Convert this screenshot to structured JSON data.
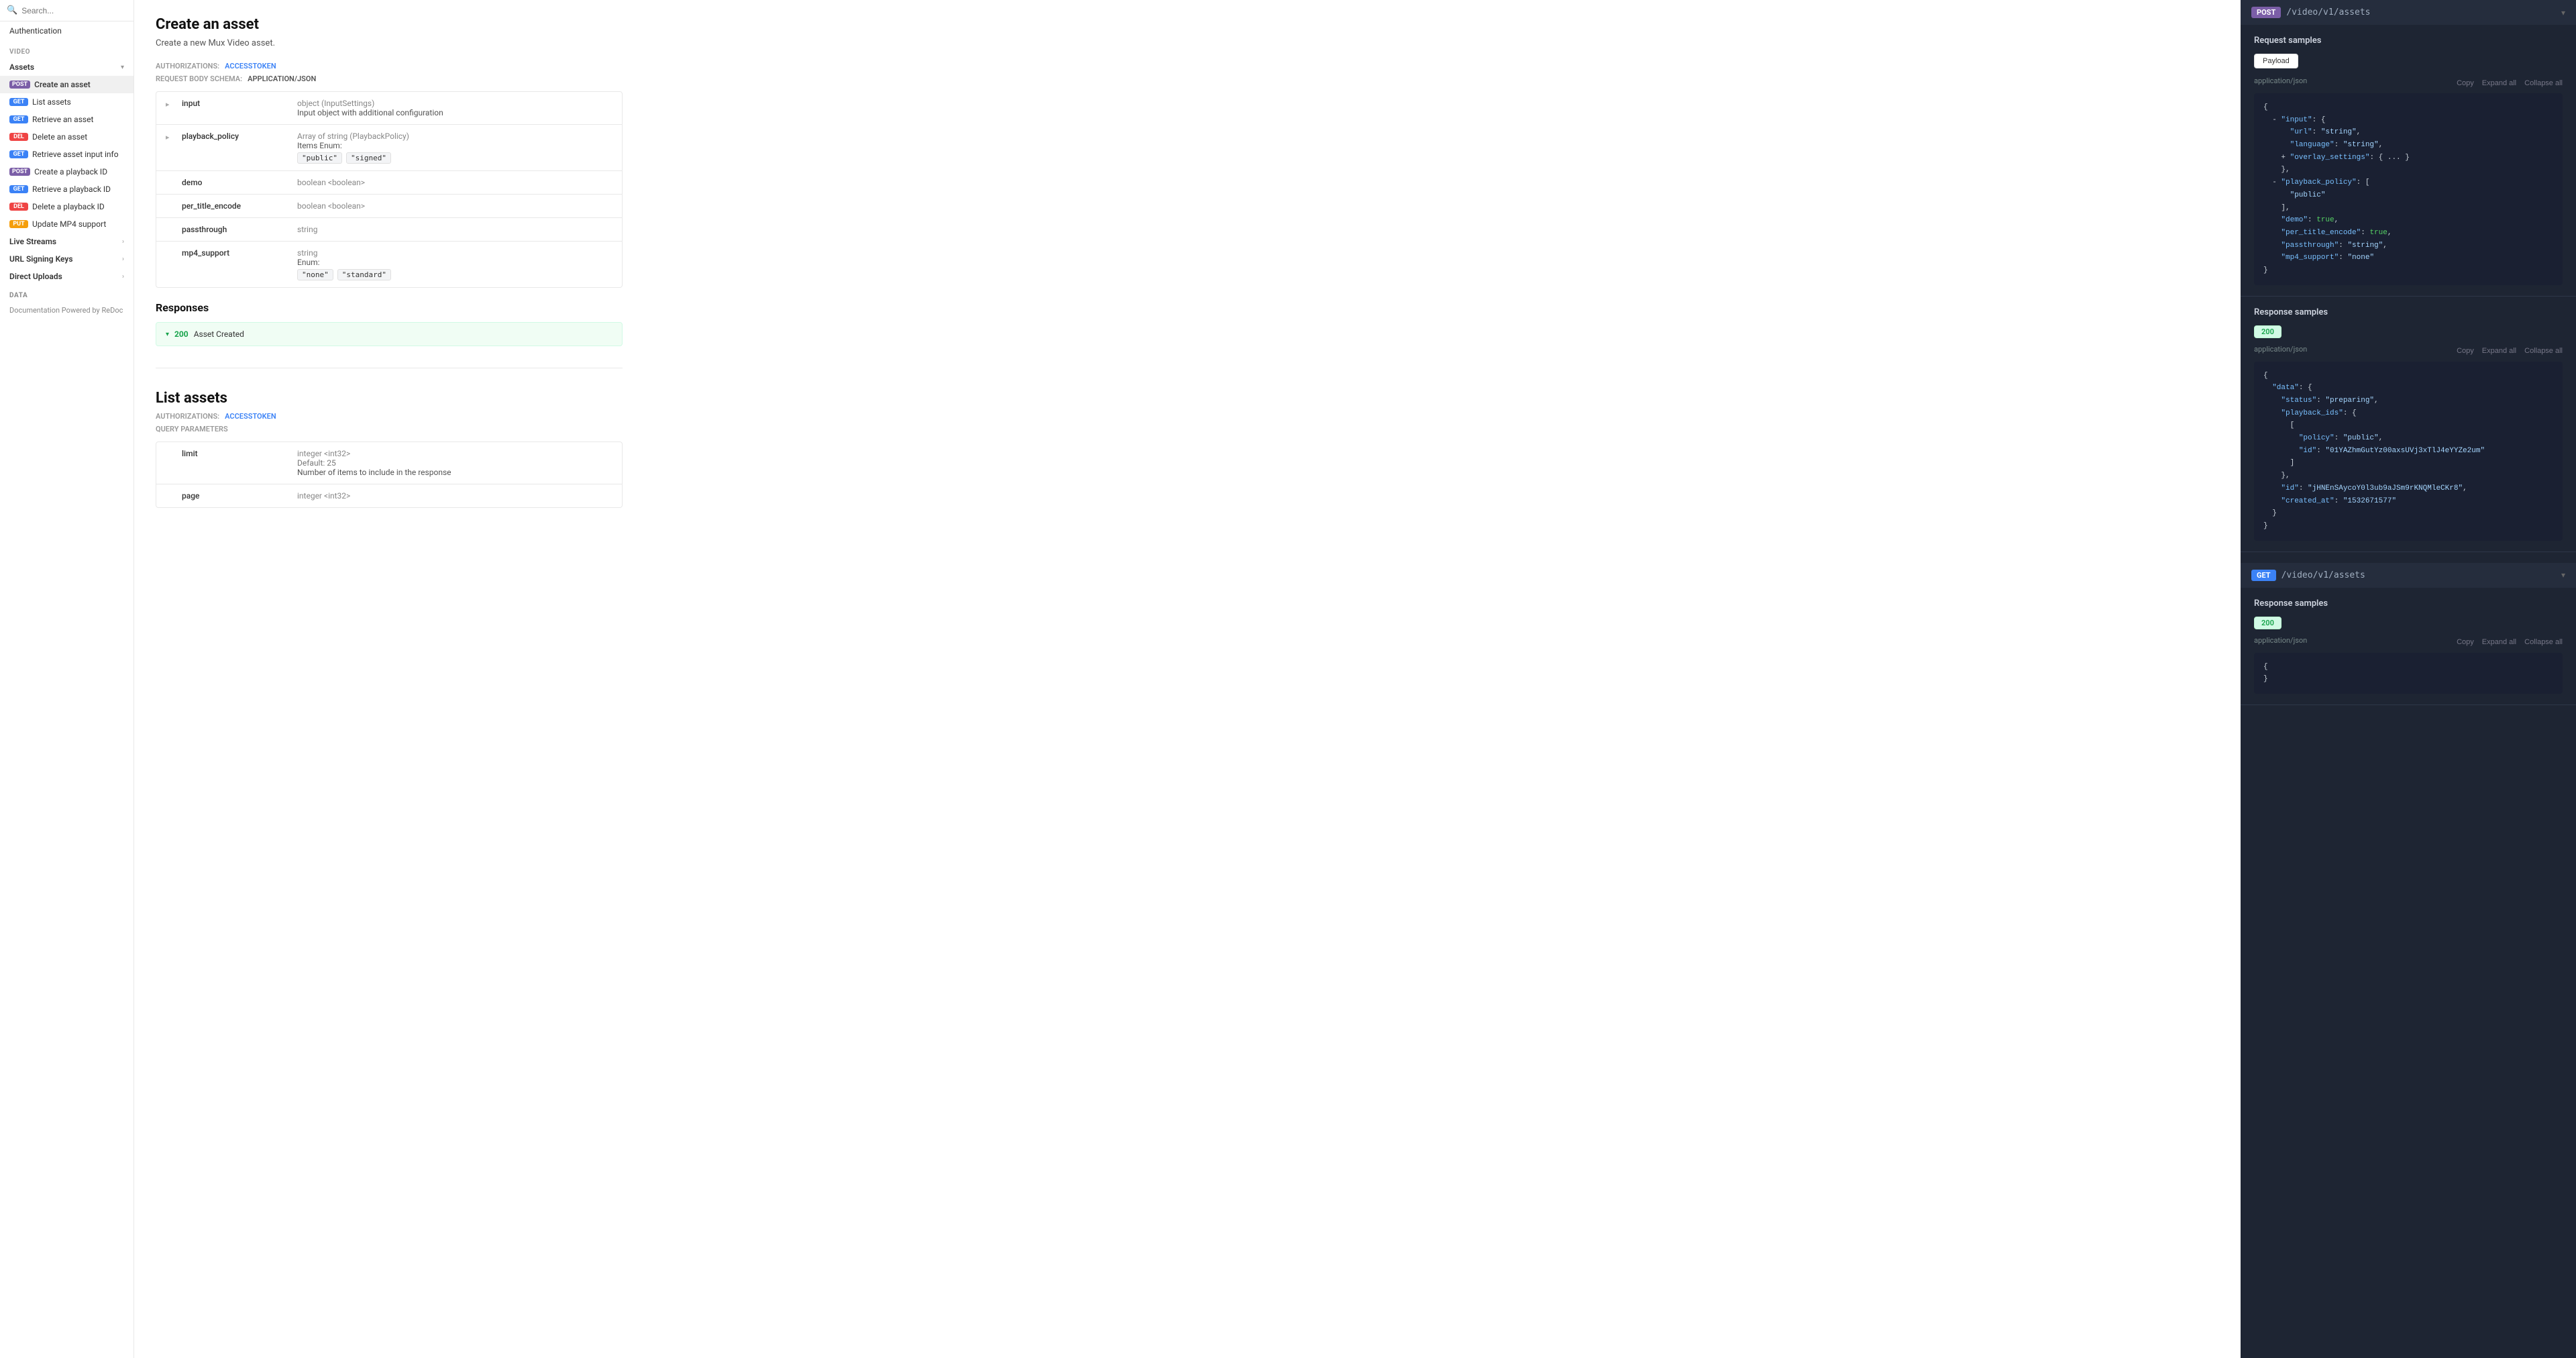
{
  "sidebar": {
    "search_placeholder": "Search...",
    "auth": {
      "label": "Authentication"
    },
    "video_label": "Video",
    "assets_label": "Assets",
    "assets_items": [
      {
        "method": "POST",
        "label": "Create an asset",
        "active": true
      },
      {
        "method": "GET",
        "label": "List assets",
        "active": false
      },
      {
        "method": "GET",
        "label": "Retrieve an asset",
        "active": false
      },
      {
        "method": "DEL",
        "label": "Delete an asset",
        "active": false
      },
      {
        "method": "GET",
        "label": "Retrieve asset input info",
        "active": false
      },
      {
        "method": "POST",
        "label": "Create a playback ID",
        "active": false
      },
      {
        "method": "GET",
        "label": "Retrieve a playback ID",
        "active": false
      },
      {
        "method": "DEL",
        "label": "Delete a playback ID",
        "active": false
      },
      {
        "method": "PUT",
        "label": "Update MP4 support",
        "active": false
      }
    ],
    "live_streams_label": "Live Streams",
    "url_signing_label": "URL Signing Keys",
    "direct_uploads_label": "Direct Uploads",
    "data_label": "Data",
    "documentation_link": "Documentation Powered by ReDoc"
  },
  "main": {
    "create_asset": {
      "title": "Create an asset",
      "subtitle": "Create a new Mux Video asset.",
      "authorizations_label": "AUTHORIZATIONS:",
      "authorizations_value": "accessToken",
      "request_body_label": "REQUEST BODY SCHEMA:",
      "request_body_value": "application/json",
      "params": [
        {
          "arrow": "▸",
          "name": "input",
          "type_tag": "object (InputSettings)",
          "description": "Input object with additional configuration"
        },
        {
          "arrow": "▸",
          "name": "playback_policy",
          "type_tag": "Array of string (PlaybackPolicy)",
          "description": "Items Enum:",
          "enums": [
            "\"public\"",
            "\"signed\""
          ]
        },
        {
          "arrow": "",
          "name": "demo",
          "type_tag": "boolean <boolean>",
          "description": ""
        },
        {
          "arrow": "",
          "name": "per_title_encode",
          "type_tag": "boolean <boolean>",
          "description": ""
        },
        {
          "arrow": "",
          "name": "passthrough",
          "type_tag": "string",
          "description": ""
        },
        {
          "arrow": "",
          "name": "mp4_support",
          "type_tag": "string",
          "description": "Enum:",
          "enums": [
            "\"none\"",
            "\"standard\""
          ]
        }
      ],
      "responses_title": "Responses",
      "response_200_code": "200",
      "response_200_desc": "Asset Created"
    },
    "list_assets": {
      "title": "List assets",
      "authorizations_label": "AUTHORIZATIONS:",
      "authorizations_value": "accessToken",
      "query_params_label": "QUERY PARAMETERS",
      "params": [
        {
          "name": "limit",
          "type_tag": "integer <int32>",
          "default": "Default: 25",
          "description": "Number of items to include in the response"
        },
        {
          "name": "page",
          "type_tag": "integer <int32>",
          "description": ""
        }
      ]
    }
  },
  "right_panel": {
    "post_endpoint": {
      "method": "POST",
      "path": "/video/v1/assets"
    },
    "get_endpoint": {
      "method": "GET",
      "path": "/video/v1/assets"
    },
    "request_samples_title": "Request samples",
    "payload_tab": "Payload",
    "content_type": "application/json",
    "copy_label": "Copy",
    "expand_label": "Expand all",
    "collapse_label": "Collapse all",
    "request_code": "{\n  - \"input\": {\n      \"url\": \"string\",\n      \"language\": \"string\",\n    + \"overlay_settings\": { ... }\n    },\n  - \"playback_policy\": [\n      \"public\"\n    ],\n    \"demo\": true,\n    \"per_title_encode\": true,\n    \"passthrough\": \"string\",\n    \"mp4_support\": \"none\"\n}",
    "response_samples_title": "Response samples",
    "response_200": "200",
    "response_code": "{\n  \"data\": {\n    \"status\": \"preparing\",\n    \"playback_ids\": {\n      [\n        \"policy\": \"public\",\n        \"id\": \"01YAZhmGutYz00axsUVj3xTlJ4eYYZe2um\"\n      ]\n    },\n    \"id\": \"jHNEnSAycoY0l3ub9aJSm9rKNQMleCKr8\",\n    \"created_at\": \"1532671577\"\n  }\n}",
    "list_response_samples_title": "Response samples",
    "list_response_200": "200",
    "list_content_type": "application/json"
  }
}
